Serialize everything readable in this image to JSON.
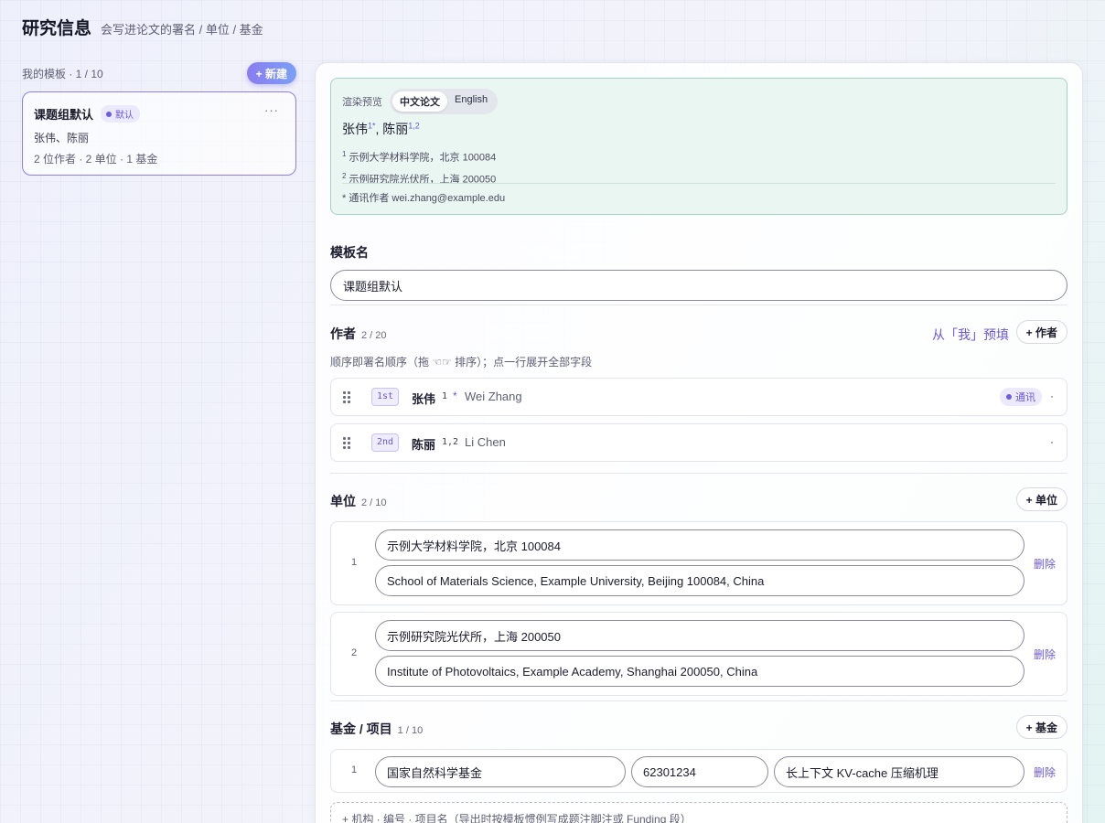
{
  "header": {
    "title": "研究信息",
    "subtitle": "会写进论文的署名 / 单位 / 基金"
  },
  "sidebar": {
    "label": "我的模板 · 1 / 10",
    "new_button": "+ 新建",
    "templates": [
      {
        "name": "课题组默认",
        "badge": "默认",
        "more": "···",
        "authors": "张伟、陈丽",
        "stats": "2 位作者 · 2 单位 · 1 基金"
      }
    ]
  },
  "preview": {
    "label": "渲染预览",
    "tabs": [
      "中文论文",
      "English"
    ],
    "active_tab": "中文论文",
    "author1": "张伟",
    "author1_sup": "1*",
    "sep": ", ",
    "author2": "陈丽",
    "author2_sup": "1,2",
    "aff1_num": "1",
    "aff1": "示例大学材料学院，北京 100084",
    "aff2_num": "2",
    "aff2": "示例研究院光伏所，上海 200050",
    "corresponding": "* 通讯作者 wei.zhang@example.edu"
  },
  "template_name": {
    "label": "模板名",
    "value": "课题组默认"
  },
  "authors": {
    "label": "作者",
    "count": "2 / 20",
    "import_link": "从「我」预填",
    "add_button": "+ 作者",
    "hint": "顺序即署名顺序（拖 ☜☞ 排序）；点一行展开全部字段",
    "rows": [
      {
        "order": "1st",
        "name": "张伟",
        "affs": "1",
        "star": "*",
        "en": "Wei Zhang",
        "badge": "通讯",
        "more": "·"
      },
      {
        "order": "2nd",
        "name": "陈丽",
        "affs": "1,2",
        "star": "",
        "en": "Li Chen",
        "badge": "",
        "more": "·"
      }
    ]
  },
  "affiliations": {
    "label": "单位",
    "count": "2 / 10",
    "add_button": "+ 单位",
    "items": [
      {
        "num": "1",
        "zh": "示例大学材料学院，北京 100084",
        "en": "School of Materials Science, Example University, Beijing 100084, China",
        "delete": "删除"
      },
      {
        "num": "2",
        "zh": "示例研究院光伏所，上海 200050",
        "en": "Institute of Photovoltaics, Example Academy, Shanghai 200050, China",
        "delete": "删除"
      }
    ]
  },
  "funding": {
    "label": "基金 / 项目",
    "count": "1 / 10",
    "add_button": "+ 基金",
    "items": [
      {
        "num": "1",
        "agency": "国家自然科学基金",
        "grant": "62301234",
        "project": "长上下文 KV-cache 压缩机理",
        "delete": "删除"
      }
    ],
    "add_hint": "+ 机构 · 编号 · 项目名（导出时按模板惯例写成题注脚注或 Funding 段）"
  },
  "colors": {
    "accent": "#6a59d8",
    "preview_bg": "#eaf6f1",
    "preview_border": "#9fd6c0"
  }
}
